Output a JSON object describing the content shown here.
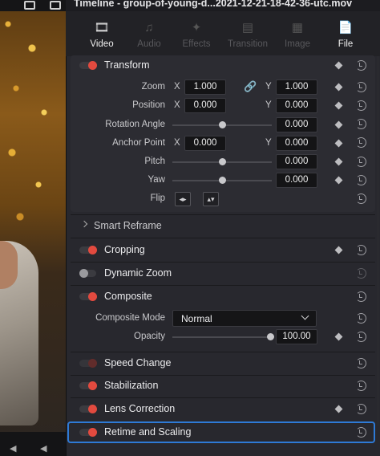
{
  "window": {
    "title": "Timeline - group-of-young-d...2021-12-21-18-42-36-utc.mov"
  },
  "tabs": [
    {
      "label": "Video",
      "icon": "film-icon",
      "active": true
    },
    {
      "label": "Audio",
      "icon": "music-note-icon",
      "active": false
    },
    {
      "label": "Effects",
      "icon": "magic-wand-icon",
      "active": false
    },
    {
      "label": "Transition",
      "icon": "transition-icon",
      "active": false
    },
    {
      "label": "Image",
      "icon": "image-icon",
      "active": false
    },
    {
      "label": "File",
      "icon": "file-icon",
      "active": true
    }
  ],
  "transform": {
    "title": "Transform",
    "zoom": {
      "label": "Zoom",
      "x_axis": "X",
      "x": "1.000",
      "y_axis": "Y",
      "y": "1.000"
    },
    "position": {
      "label": "Position",
      "x_axis": "X",
      "x": "0.000",
      "y_axis": "Y",
      "y": "0.000"
    },
    "rotation_angle": {
      "label": "Rotation Angle",
      "value": "0.000"
    },
    "anchor_point": {
      "label": "Anchor Point",
      "x_axis": "X",
      "x": "0.000",
      "y_axis": "Y",
      "y": "0.000"
    },
    "pitch": {
      "label": "Pitch",
      "value": "0.000"
    },
    "yaw": {
      "label": "Yaw",
      "value": "0.000"
    },
    "flip": {
      "label": "Flip"
    }
  },
  "smart_reframe": {
    "title": "Smart Reframe"
  },
  "cropping": {
    "title": "Cropping",
    "enabled": true
  },
  "dynamic_zoom": {
    "title": "Dynamic Zoom",
    "enabled": false
  },
  "composite": {
    "title": "Composite",
    "enabled": true,
    "mode": {
      "label": "Composite Mode",
      "value": "Normal"
    },
    "opacity": {
      "label": "Opacity",
      "value": "100.00",
      "level": 1.0
    }
  },
  "speed_change": {
    "title": "Speed Change",
    "enabled": true
  },
  "stabilization": {
    "title": "Stabilization",
    "enabled": true
  },
  "lens_correction": {
    "title": "Lens Correction",
    "enabled": true
  },
  "retime_scaling": {
    "title": "Retime and Scaling",
    "enabled": true
  },
  "colors": {
    "accent_red": "#e24a3f",
    "selection_blue": "#2e7ad6"
  }
}
